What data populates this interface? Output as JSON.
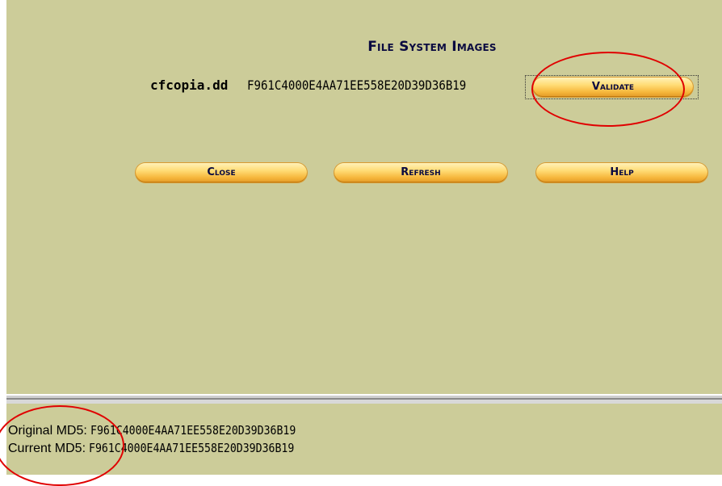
{
  "file_system_images": {
    "title": "File System Images",
    "files": [
      {
        "name": "cfcopia.dd",
        "hash": "F961C4000E4AA71EE558E20D39D36B19",
        "validate_label": "Validate"
      }
    ],
    "buttons": {
      "close_label": "Close",
      "refresh_label": "Refresh",
      "help_label": "Help"
    }
  },
  "md5_panel": {
    "original_label": "Original MD5: ",
    "original_value": "F961C4000E4AA71EE558E20D39D36B19",
    "current_label": "Current MD5: ",
    "current_value": "F961C4000E4AA71EE558E20D39D36B19"
  },
  "colors": {
    "frame_background": "#cccc99",
    "button_gradient_top": "#fff1b8",
    "button_gradient_bottom": "#e39a26",
    "button_text": "#0a0a40",
    "annotation_circle": "#e00000"
  }
}
